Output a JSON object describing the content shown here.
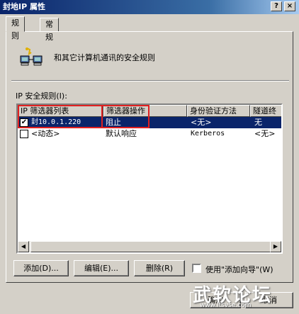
{
  "window": {
    "title": "封地IP 属性",
    "help": "?",
    "close": "×"
  },
  "tabs": [
    {
      "label": "规则"
    },
    {
      "label": "常规"
    }
  ],
  "description": "和其它计算机通讯的安全规则",
  "list_label": "IP 安全规则(I):",
  "columns": [
    "IP 筛选器列表",
    "筛选器操作",
    "身份验证方法",
    "隧道终"
  ],
  "rows": [
    {
      "checked": true,
      "filter_list": "封10.0.1.220",
      "action": "阻止",
      "auth": "<无>",
      "tunnel": "无"
    },
    {
      "checked": false,
      "filter_list": "<动态>",
      "action": "默认响应",
      "auth": "Kerberos",
      "tunnel": "<无>"
    }
  ],
  "buttons": {
    "add": "添加(D)...",
    "edit": "编辑(E)...",
    "remove": "删除(R)"
  },
  "wizard_checkbox": {
    "label": "使用\"添加向导\"(W)",
    "checked": false
  },
  "footer": {
    "ok": "确定",
    "cancel": "取消"
  },
  "watermark": {
    "main": "武软论坛",
    "sub": "www.itsvse.com"
  },
  "icons": {
    "network": "network-computers-icon",
    "check": "check-icon"
  }
}
